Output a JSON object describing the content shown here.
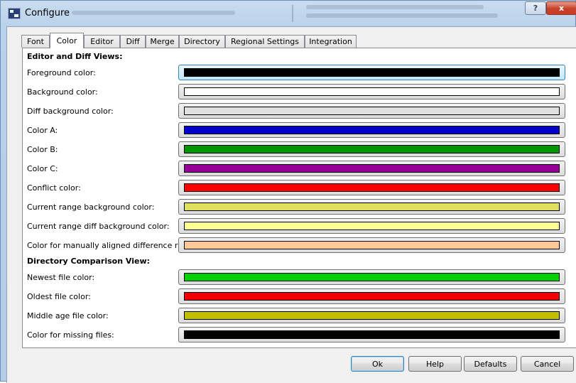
{
  "window": {
    "title": "Configure",
    "help_glyph": "?",
    "close_glyph": "x"
  },
  "tabs": [
    {
      "label": "Font"
    },
    {
      "label": "Color",
      "active": true
    },
    {
      "label": "Editor"
    },
    {
      "label": "Diff"
    },
    {
      "label": "Merge"
    },
    {
      "label": "Directory"
    },
    {
      "label": "Regional Settings"
    },
    {
      "label": "Integration"
    }
  ],
  "editor_section": {
    "title": "Editor and Diff Views:",
    "rows": [
      {
        "label": "Foreground color:",
        "color": "#000000"
      },
      {
        "label": "Background color:",
        "color": "#ffffff"
      },
      {
        "label": "Diff background color:",
        "color": "#e0e0e0"
      },
      {
        "label": "Color A:",
        "color": "#0000c8"
      },
      {
        "label": "Color B:",
        "color": "#009600"
      },
      {
        "label": "Color C:",
        "color": "#960096"
      },
      {
        "label": "Conflict color:",
        "color": "#ff0000"
      },
      {
        "label": "Current range background color:",
        "color": "#e0e060"
      },
      {
        "label": "Current range diff background color:",
        "color": "#ffff96"
      },
      {
        "label": "Color for manually aligned difference ranges:",
        "color": "#ffc896"
      }
    ]
  },
  "directory_section": {
    "title": "Directory Comparison View:",
    "rows": [
      {
        "label": "Newest file color:",
        "color": "#00d200"
      },
      {
        "label": "Oldest file color:",
        "color": "#f00000"
      },
      {
        "label": "Middle age file color:",
        "color": "#c0c000"
      },
      {
        "label": "Color for missing files:",
        "color": "#000000"
      }
    ]
  },
  "buttons": {
    "ok": "Ok",
    "help": "Help",
    "defaults": "Defaults",
    "cancel": "Cancel"
  }
}
